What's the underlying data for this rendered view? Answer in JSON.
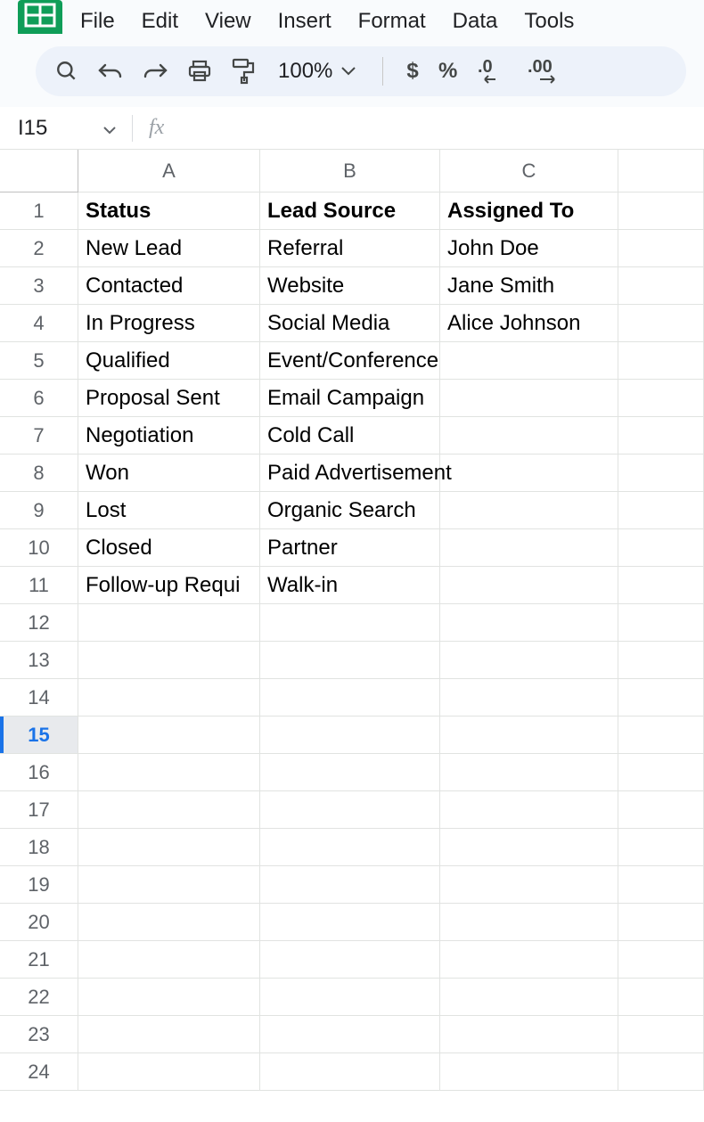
{
  "menu": {
    "items": [
      "File",
      "Edit",
      "View",
      "Insert",
      "Format",
      "Data",
      "Tools"
    ]
  },
  "toolbar": {
    "zoom": "100%",
    "currency": "$",
    "percent": "%",
    "dec_decrease": ".0",
    "dec_increase": ".00"
  },
  "namebox": {
    "value": "I15",
    "fx_label": "fx"
  },
  "grid": {
    "columns": [
      "A",
      "B",
      "C"
    ],
    "visible_rows": 24,
    "selected_row": 15,
    "headers": [
      "Status",
      "Lead Source",
      "Assigned To"
    ],
    "rows": [
      {
        "A": "New Lead",
        "B": "Referral",
        "C": "John Doe"
      },
      {
        "A": "Contacted",
        "B": "Website",
        "C": "Jane Smith"
      },
      {
        "A": "In Progress",
        "B": "Social Media",
        "C": "Alice Johnson"
      },
      {
        "A": "Qualified",
        "B": "Event/Conference",
        "C": ""
      },
      {
        "A": "Proposal Sent",
        "B": "Email Campaign",
        "C": ""
      },
      {
        "A": "Negotiation",
        "B": "Cold Call",
        "C": ""
      },
      {
        "A": "Won",
        "B": "Paid Advertisement",
        "C": ""
      },
      {
        "A": "Lost",
        "B": "Organic Search",
        "C": ""
      },
      {
        "A": "Closed",
        "B": "Partner",
        "C": ""
      },
      {
        "A": "Follow-up Requi",
        "B": "Walk-in",
        "C": ""
      }
    ]
  }
}
